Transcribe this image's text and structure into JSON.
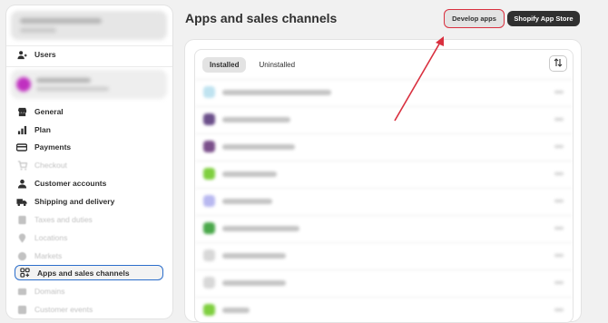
{
  "sidebar": {
    "items": [
      {
        "label": "Users",
        "icon": "users-icon",
        "state": "normal"
      },
      {
        "label": "General",
        "icon": "store-icon",
        "state": "normal"
      },
      {
        "label": "Plan",
        "icon": "plan-chart-icon",
        "state": "normal"
      },
      {
        "label": "Payments",
        "icon": "payments-icon",
        "state": "normal"
      },
      {
        "label": "Checkout",
        "icon": "cart-icon",
        "state": "dimmed"
      },
      {
        "label": "Customer accounts",
        "icon": "person-icon",
        "state": "normal"
      },
      {
        "label": "Shipping and delivery",
        "icon": "truck-icon",
        "state": "normal"
      },
      {
        "label": "Taxes and duties",
        "icon": "tax-icon",
        "state": "dimmed"
      },
      {
        "label": "Locations",
        "icon": "location-icon",
        "state": "dimmed"
      },
      {
        "label": "Markets",
        "icon": "globe-icon",
        "state": "dimmed"
      },
      {
        "label": "Apps and sales channels",
        "icon": "apps-icon",
        "state": "active"
      },
      {
        "label": "Domains",
        "icon": "domain-icon",
        "state": "dimmed"
      },
      {
        "label": "Customer events",
        "icon": "events-icon",
        "state": "dimmed"
      }
    ]
  },
  "header": {
    "title": "Apps and sales channels",
    "develop_apps_label": "Develop apps",
    "app_store_label": "Shopify App Store"
  },
  "tabs": [
    {
      "label": "Installed",
      "active": true
    },
    {
      "label": "Uninstalled",
      "active": false
    }
  ],
  "apps": [
    {
      "icon_color": "#bfe3f0"
    },
    {
      "icon_color": "#6b4f8a"
    },
    {
      "icon_color": "#7a4f8a"
    },
    {
      "icon_color": "#7fcf3f"
    },
    {
      "icon_color": "#b8b8f0"
    },
    {
      "icon_color": "#4aa84a"
    },
    {
      "icon_color": "#d8d8d8"
    },
    {
      "icon_color": "#d8d8d8"
    },
    {
      "icon_color": "#7fcf3f"
    }
  ],
  "colors": {
    "accent_outline": "#2c6ecb",
    "highlight_red": "#d9303f",
    "primary_dark": "#303030"
  }
}
